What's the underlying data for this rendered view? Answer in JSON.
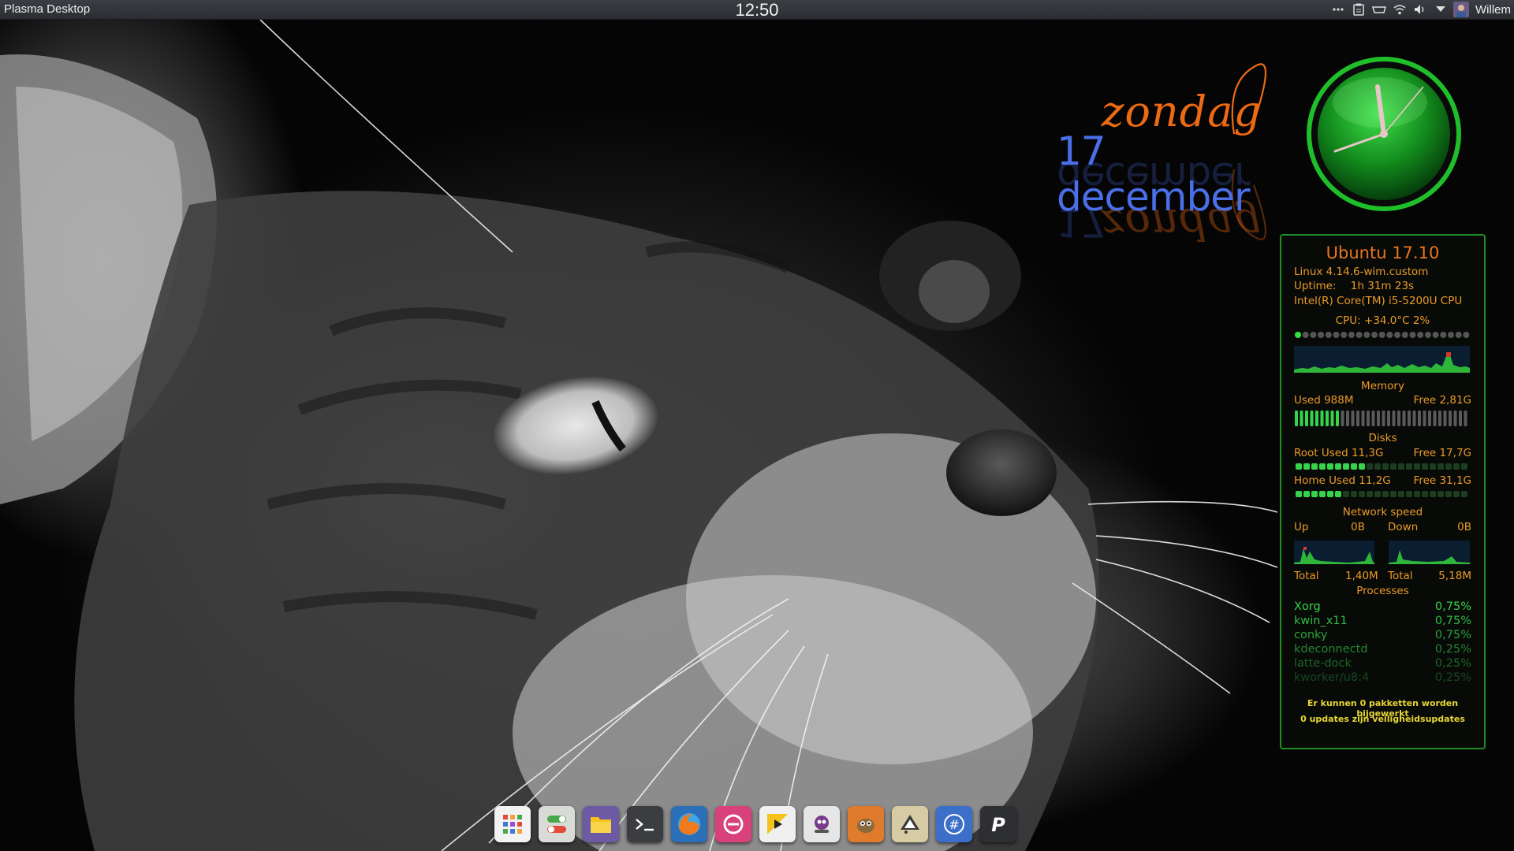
{
  "top_panel": {
    "activity_label": "Plasma Desktop",
    "clock": "12:50",
    "user_name": "Willem",
    "tray_icons": [
      "more-dots-icon",
      "clipboard-icon",
      "kdeconnect-icon",
      "wifi-icon",
      "volume-icon",
      "arrow-down-icon",
      "user-avatar-icon"
    ]
  },
  "date_widget": {
    "day": "zondag",
    "date": "17 december",
    "day_color": "#ec6a13",
    "date_color": "#4a6fe8"
  },
  "analog_clock": {
    "time": "12:50",
    "face_color": "#1f8f23"
  },
  "conky": {
    "title": "Ubuntu 17.10",
    "kernel": "Linux 4.14.6-wim.custom",
    "uptime_label": "Uptime:",
    "uptime_value": "1h 31m 23s",
    "cpu_model": "Intel(R) Core(TM) i5-5200U CPU",
    "cpu_line": "CPU: +34.0°C  2%",
    "cpu_percent": 2,
    "memory": {
      "heading": "Memory",
      "used_label": "Used 988M",
      "free_label": "Free 2,81G",
      "used_fraction": 0.26
    },
    "disks": {
      "heading": "Disks",
      "root_used": "Root Used 11,3G",
      "root_free": "Free 17,7G",
      "root_fraction": 0.39,
      "home_used": "Home Used 11,2G",
      "home_free": "Free 31,1G",
      "home_fraction": 0.26
    },
    "network": {
      "heading": "Network speed",
      "up_label": "Up",
      "up_value": "0B",
      "down_label": "Down",
      "down_value": "0B",
      "total_label_up": "Total",
      "total_up": "1,40M",
      "total_label_down": "Total",
      "total_down": "5,18M"
    },
    "processes": {
      "heading": "Processes",
      "rows": [
        {
          "name": "Xorg",
          "cpu": "0,75%"
        },
        {
          "name": "kwin_x11",
          "cpu": "0,75%"
        },
        {
          "name": "conky",
          "cpu": "0,75%"
        },
        {
          "name": "kdeconnectd",
          "cpu": "0,25%"
        },
        {
          "name": "latte-dock",
          "cpu": "0,25%"
        },
        {
          "name": "kworker/u8:4",
          "cpu": "0,25%"
        }
      ]
    },
    "updates_line1": "Er kunnen 0 pakketten worden bijgewerkt",
    "updates_line2": "0 updates zijn veiligheidsupdates"
  },
  "dock": {
    "items": [
      {
        "name": "app-launcher-icon",
        "color": "#f2f2f2"
      },
      {
        "name": "settings-toggle-icon",
        "color": "#d9dcd6"
      },
      {
        "name": "file-manager-icon",
        "color": "#6c5ba4"
      },
      {
        "name": "terminal-icon",
        "color": "#3b3d40"
      },
      {
        "name": "firefox-icon",
        "color": "#2a6fb8"
      },
      {
        "name": "anydesk-icon",
        "color": "#d8417a"
      },
      {
        "name": "media-player-icon",
        "color": "#f0f0f0"
      },
      {
        "name": "steam-icon",
        "color": "#e6e6e6"
      },
      {
        "name": "gimp-icon",
        "color": "#e07a2c"
      },
      {
        "name": "inkscape-icon",
        "color": "#d6cba3"
      },
      {
        "name": "hashtag-chat-icon",
        "color": "#3b6fc9"
      },
      {
        "name": "p-app-icon",
        "color": "#2d2f33"
      }
    ]
  }
}
